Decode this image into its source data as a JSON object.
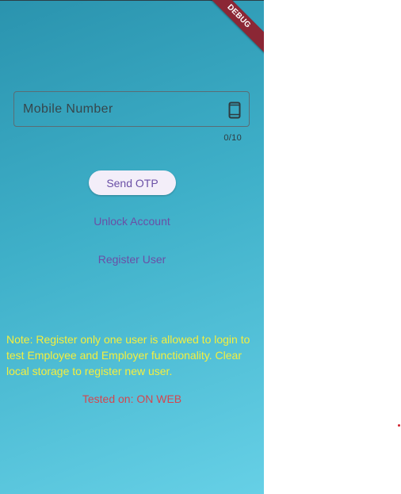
{
  "banner": {
    "label": "DEBUG"
  },
  "mobile_field": {
    "placeholder": "Mobile Number",
    "value": "",
    "counter": "0/10",
    "icon": "smartphone-icon"
  },
  "actions": {
    "send_otp": "Send OTP",
    "unlock_account": "Unlock Account",
    "register_user": "Register User"
  },
  "note": "Note: Register only one user is allowed to login to test Employee and Employer functionality. Clear local storage to register new user.",
  "tested_on": "Tested on: ON WEB",
  "colors": {
    "note": "#f4ef3e",
    "tested": "#d4464f",
    "accent": "#6a4fa6",
    "banner": "#8b2735"
  }
}
